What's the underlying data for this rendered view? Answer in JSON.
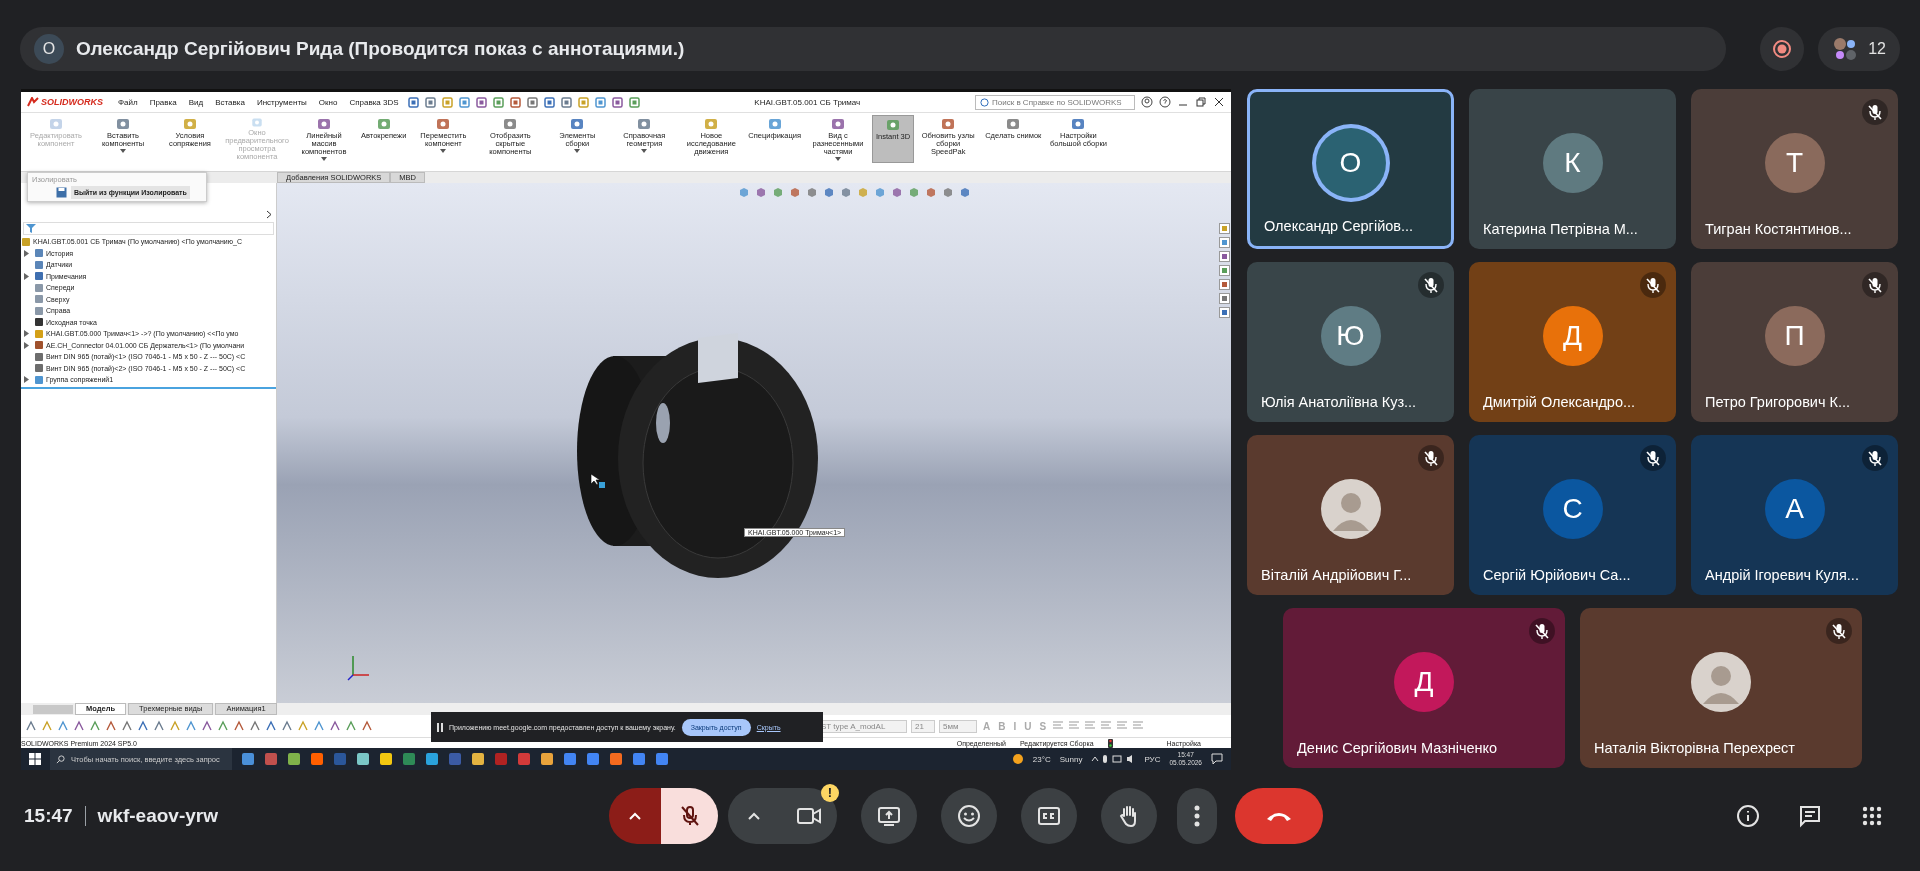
{
  "call_bar": {
    "presenter_initial": "О",
    "presenter_title": "Олександр Сергійович Рида (Проводится показ с аннотациями.)",
    "participant_count": "12"
  },
  "shared_screen": {
    "logo": "SOLIDWORKS",
    "menu": [
      "Файл",
      "Правка",
      "Вид",
      "Вставка",
      "Инструменты",
      "Окно",
      "Справка 3DS"
    ],
    "window_title": "KHAI.GBT.05.001 СБ Тримач",
    "search": {
      "placeholder": "Поиск в Справке по SOLIDWORKS"
    },
    "ribbon": [
      {
        "label": "Редактировать компонент",
        "disabled": true,
        "selected": false,
        "dropdown": false
      },
      {
        "label": "Вставить компоненты",
        "disabled": false,
        "selected": false,
        "dropdown": true
      },
      {
        "label": "Условия сопряжения",
        "disabled": false,
        "selected": false,
        "dropdown": false
      },
      {
        "label": "Окно предварительного просмотра компонента",
        "disabled": true,
        "selected": false,
        "dropdown": false
      },
      {
        "label": "Линейный массив компонентов",
        "disabled": false,
        "selected": false,
        "dropdown": true
      },
      {
        "label": "Автокрепежи",
        "disabled": false,
        "selected": false,
        "dropdown": false
      },
      {
        "label": "Переместить компонент",
        "disabled": false,
        "selected": false,
        "dropdown": true
      },
      {
        "label": "Отобразить скрытые компоненты",
        "disabled": false,
        "selected": false,
        "dropdown": false
      },
      {
        "label": "Элементы сборки",
        "disabled": false,
        "selected": false,
        "dropdown": true
      },
      {
        "label": "Справочная геометрия",
        "disabled": false,
        "selected": false,
        "dropdown": true
      },
      {
        "label": "Новое исследование движения",
        "disabled": false,
        "selected": false,
        "dropdown": false
      },
      {
        "label": "Спецификация",
        "disabled": false,
        "selected": false,
        "dropdown": false
      },
      {
        "label": "Вид с разнесенными частями",
        "disabled": false,
        "selected": false,
        "dropdown": true
      },
      {
        "label": "Instant 3D",
        "disabled": false,
        "selected": true,
        "dropdown": false
      },
      {
        "label": "Обновить узлы сборки SpeedPak",
        "disabled": false,
        "selected": false,
        "dropdown": false
      },
      {
        "label": "Сделать снимок",
        "disabled": false,
        "selected": false,
        "dropdown": false
      },
      {
        "label": "Настройки большой сборки",
        "disabled": false,
        "selected": false,
        "dropdown": false
      }
    ],
    "command_tabs": [
      {
        "label": "Добавления SOLIDWORKS"
      },
      {
        "label": "MBD"
      }
    ],
    "isolate_popup": {
      "title": "Изолировать",
      "button": "Выйти из функции Изолировать"
    },
    "tree": {
      "label": "KHAI.GBT.05.001 СБ Тримач (По умолчанию) <По умолчанию_С",
      "kind": "assembly",
      "children": [
        {
          "label": "История",
          "kind": "folder",
          "expandable": true
        },
        {
          "label": "Датчики",
          "kind": "sensor",
          "expandable": false
        },
        {
          "label": "Примечания",
          "kind": "notes",
          "expandable": true
        },
        {
          "label": "Спереди",
          "kind": "plane",
          "expandable": false
        },
        {
          "label": "Сверху",
          "kind": "plane",
          "expandable": false
        },
        {
          "label": "Справа",
          "kind": "plane",
          "expandable": false
        },
        {
          "label": "Исходная точка",
          "kind": "origin",
          "expandable": false
        },
        {
          "label": "KHAI.GBT.05.000 Тримач<1> ->? (По умолчанию) <<По умо",
          "kind": "part",
          "expandable": true
        },
        {
          "label": "AE.CH_Connector 04.01.000 СБ Держатель<1> (По умолчани",
          "kind": "subassembly",
          "expandable": true
        },
        {
          "label": "Винт DIN 965 (потай)<1> (ISO 7046-1 - M5 x 50 - Z --- 50C) <С",
          "kind": "screw",
          "expandable": false
        },
        {
          "label": "Винт DIN 965 (потай)<2> (ISO 7046-1 - M5 x 50 - Z --- 50C) <С",
          "kind": "screw",
          "expandable": false
        },
        {
          "label": "Группа сопряжений1",
          "kind": "mates",
          "expandable": true
        }
      ]
    },
    "viewport": {
      "tooltip": "KHAI.GBT.05.000 Тримач<1>"
    },
    "bottom_tabs": [
      {
        "label": "Модель",
        "selected": true
      },
      {
        "label": "Трехмерные виды",
        "selected": false
      },
      {
        "label": "Анимация1",
        "selected": false
      }
    ],
    "font_bar": {
      "font": "ST type A_modAL",
      "size": "21",
      "height": "5мм",
      "format_buttons": [
        "A",
        "B",
        "I",
        "U",
        "S"
      ]
    },
    "status_bar": {
      "product": "SOLIDWORKS Premium 2024 SP5.0",
      "items": [
        "Определенный",
        "Редактируется Сборка"
      ],
      "settings": "Настройка"
    },
    "share_notice": {
      "text": "Приложению meet.google.com предоставлен доступ к вашему экрану.",
      "stop_button": "Закрыть доступ",
      "hide_link": "Скрыть"
    },
    "taskbar": {
      "search_placeholder": "Чтобы начать поиск, введите здесь запрос",
      "temperature": "23°C",
      "weather": "Sunny",
      "language": "РУС",
      "time": "15:47",
      "date": "05.05.2026"
    }
  },
  "tiles": [
    {
      "name": "Олександр Сергійов...",
      "initial": "О",
      "kind": "letter",
      "color": "#2b6272",
      "muted": false,
      "speaking": true
    },
    {
      "name": "Катерина Петрівна М...",
      "initial": "К",
      "kind": "letter",
      "color": "#5f7a80",
      "muted": false,
      "speaking": false
    },
    {
      "name": "Тигран Костянтинов...",
      "initial": "Т",
      "kind": "letter",
      "color": "#8a6a5c",
      "muted": true,
      "speaking": false
    },
    {
      "name": "Юлія Анатоліївна Куз...",
      "initial": "Ю",
      "kind": "letter",
      "color": "#5f7c84",
      "muted": true,
      "speaking": false
    },
    {
      "name": "Дмитрій Олександро...",
      "initial": "Д",
      "kind": "letter",
      "color": "#e8710a",
      "muted": true,
      "speaking": false
    },
    {
      "name": "Петро Григорович К...",
      "initial": "П",
      "kind": "letter",
      "color": "#8b6a5c",
      "muted": true,
      "speaking": false
    },
    {
      "name": "Віталій Андрійович Г...",
      "kind": "photo",
      "muted": true,
      "speaking": false
    },
    {
      "name": "Сергій Юрійович Са...",
      "initial": "С",
      "kind": "letter",
      "color": "#0b57a0",
      "muted": true,
      "speaking": false
    },
    {
      "name": "Андрій Ігоревич Куля...",
      "initial": "А",
      "kind": "letter",
      "color": "#0b57a0",
      "muted": true,
      "speaking": false
    },
    {
      "name": "Денис Сергійович Мазніченко",
      "initial": "Д",
      "kind": "letter",
      "color": "#c2185b",
      "muted": true,
      "speaking": false
    },
    {
      "name": "Наталія Вікторівна Перехрест",
      "kind": "photo",
      "muted": true,
      "speaking": false
    }
  ],
  "footer": {
    "time": "15:47",
    "meeting_code": "wkf-eaov-yrw"
  },
  "controls": {
    "mic_muted": true,
    "camera_alert": "!"
  }
}
